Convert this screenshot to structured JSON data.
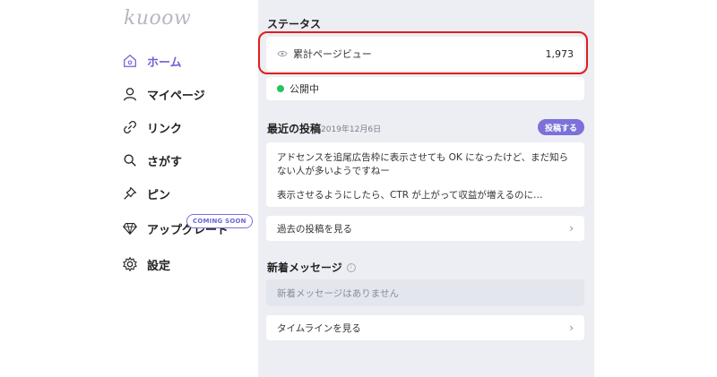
{
  "brand": {
    "logo": "kuoow"
  },
  "sidebar": {
    "items": [
      {
        "label": "ホーム",
        "icon": "home-icon",
        "active": true
      },
      {
        "label": "マイページ",
        "icon": "user-icon",
        "active": false
      },
      {
        "label": "リンク",
        "icon": "link-icon",
        "active": false
      },
      {
        "label": "さがす",
        "icon": "search-icon",
        "active": false
      },
      {
        "label": "ピン",
        "icon": "pin-icon",
        "active": false
      },
      {
        "label": "アップグレード",
        "icon": "diamond-icon",
        "active": false,
        "badge": "COMING SOON"
      },
      {
        "label": "設定",
        "icon": "gear-icon",
        "active": false
      }
    ]
  },
  "status": {
    "title": "ステータス",
    "pageviews_label": "累計ページビュー",
    "pageviews_value": "1,973",
    "public_label": "公開中"
  },
  "recent": {
    "title": "最近の投稿",
    "date": "2019年12月6日",
    "post_button": "投稿する",
    "post_text_1": "アドセンスを追尾広告枠に表示させても OK になったけど、まだ知らない人が多いようですねー",
    "post_text_2": "表示させるようにしたら、CTR が上がって収益が増えるのに…",
    "past_link": "過去の投稿を見る"
  },
  "messages": {
    "title": "新着メッセージ",
    "empty": "新着メッセージはありません",
    "timeline_link": "タイムラインを見る"
  },
  "colors": {
    "accent": "#6d63d4",
    "highlight": "#e11d1d",
    "public_dot": "#22c55e"
  }
}
